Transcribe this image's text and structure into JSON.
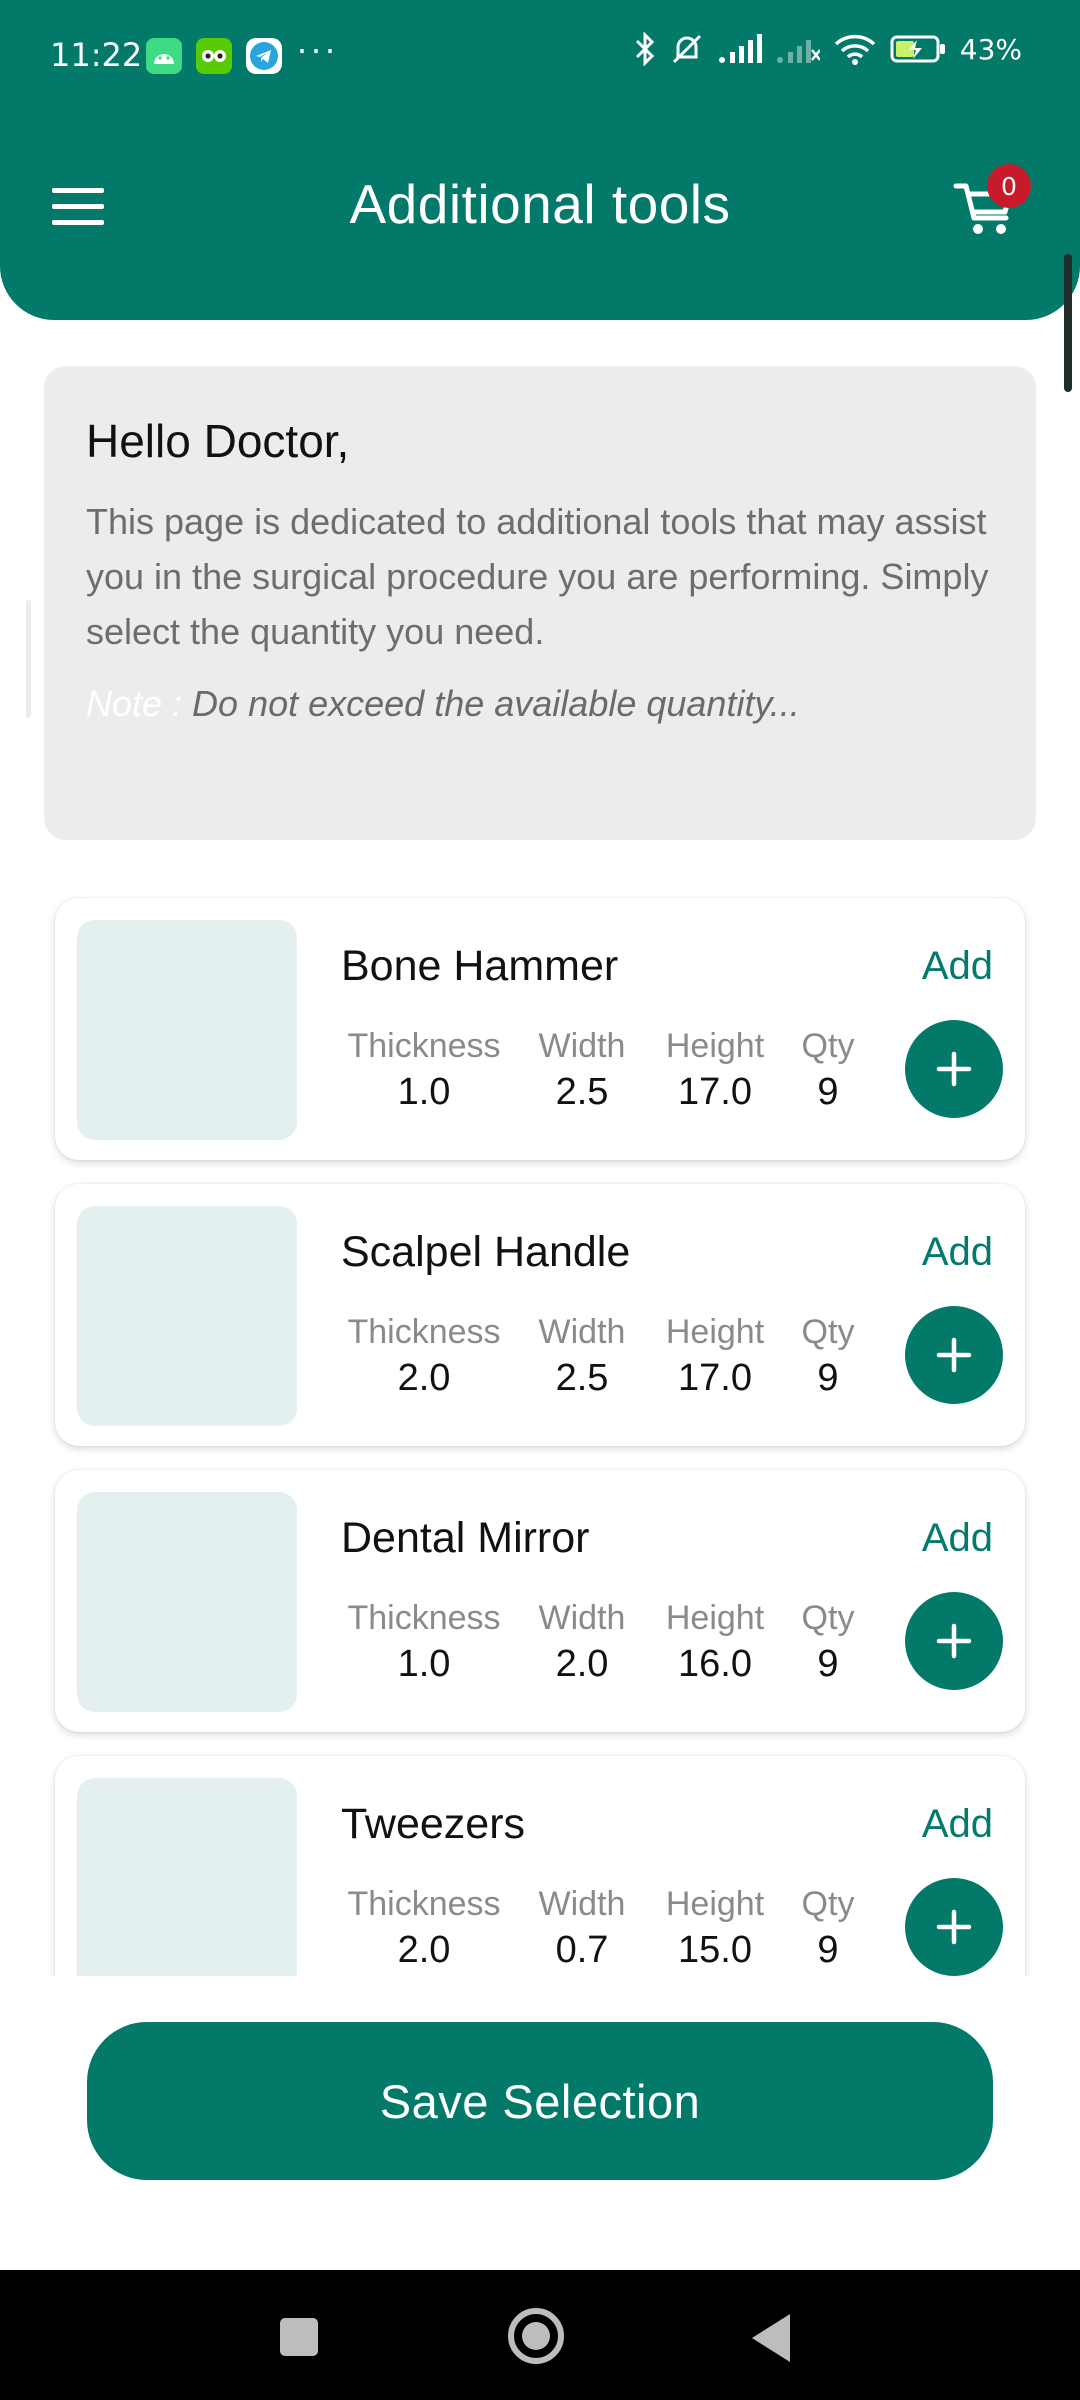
{
  "status_bar": {
    "time": "11:22",
    "more": "···",
    "battery": "43%",
    "icons": [
      "android-app-icon",
      "duolingo-app-icon",
      "telegram-app-icon",
      "bluetooth-icon",
      "silent-icon",
      "signal-icon",
      "signal-weak-icon",
      "wifi-icon",
      "battery-charging-icon"
    ]
  },
  "header": {
    "title": "Additional tools",
    "cart_count": "0",
    "menu_icon": "hamburger-menu-icon",
    "cart_icon": "cart-icon",
    "background_color": "#03796a"
  },
  "intro": {
    "greeting": "Hello Doctor,",
    "text": "This page is dedicated to additional tools that may assist you in the surgical procedure you are performing. Simply select the quantity you need.",
    "note_label": "Note :",
    "note_text": " Do not exceed the available quantity..."
  },
  "spec_labels": {
    "thickness": "Thickness",
    "width": "Width",
    "height": "Height",
    "qty": "Qty"
  },
  "add_label": "Add",
  "tools": [
    {
      "name": "Bone Hammer",
      "thickness": "1.0",
      "width": "2.5",
      "height": "17.0",
      "qty": "9"
    },
    {
      "name": "Scalpel Handle",
      "thickness": "2.0",
      "width": "2.5",
      "height": "17.0",
      "qty": "9"
    },
    {
      "name": "Dental Mirror",
      "thickness": "1.0",
      "width": "2.0",
      "height": "16.0",
      "qty": "9"
    },
    {
      "name": "Tweezers",
      "thickness": "2.0",
      "width": "0.7",
      "height": "15.0",
      "qty": "9"
    }
  ],
  "save_button": "Save Selection",
  "accent_color": "#03796a",
  "badge_color": "#c81a2a"
}
